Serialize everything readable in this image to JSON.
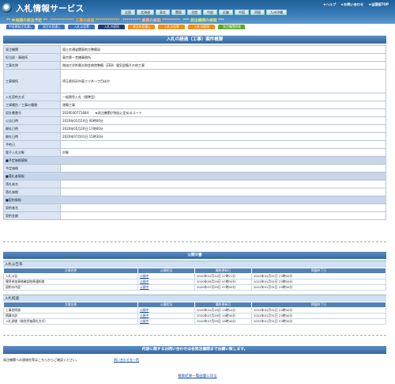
{
  "header": {
    "title": "入札情報サービス",
    "top_links": [
      "★ヘルプ",
      "★お問い合わせ",
      "★全国版TOP"
    ],
    "regions": [
      "全国",
      "北海道",
      "東北",
      "関東",
      "北陸",
      "中部",
      "近畿",
      "中国",
      "四国",
      "九州沖縄"
    ],
    "categories": [
      "** 中長期の発注予定 **",
      "************ 工事の検索 ************",
      "********* 業務の検索 *********",
      "*** 発注機関の検索 ***"
    ]
  },
  "subtabs": [
    "中長期発注見通し",
    "発注の見通し",
    "入札公告等",
    "入札の経過",
    "発注の見通し",
    "入札公告等",
    "入札の経過",
    "発注機関情報"
  ],
  "detail": {
    "heading": "入札の経過（工事）案件概要",
    "rows": [
      {
        "k": "発注機関",
        "v": "国土交通省関東地方整備局"
      },
      {
        "k": "担当部・事務所",
        "v": "東京第一営繕事務所"
      },
      {
        "k": "工事名称",
        "v": "独協大学附属光和会病院整備（ZEB）電気設備その他工事"
      },
      {
        "k": "工事場所",
        "v": "埼玉県所沢市東二ツ木一丁目ほか"
      },
      {
        "k": "入札契約方式",
        "v": "一般競争入札（標準型）"
      },
      {
        "k": "工事種別／工事の種類",
        "v": "建築工事"
      },
      {
        "k": "設計書番号",
        "v": "2020030771684　　★発注機関が独自に定めるコード"
      },
      {
        "k": "公告日時",
        "v": "2020年01月14日 00時00分"
      },
      {
        "k": "開札日時",
        "v": "2020年05月20日 17時00分"
      },
      {
        "k": "開札日時",
        "v": "2020年07月01日 15時30分"
      },
      {
        "k": "予約日",
        "v": ""
      },
      {
        "k": "電子入札対象",
        "v": "対象"
      }
    ],
    "sections": [
      {
        "head": "■予定価格情報",
        "rows": [
          {
            "k": "予定価格",
            "v": ""
          }
        ]
      },
      {
        "head": "■落札者情報",
        "rows": [
          {
            "k": "落札者名",
            "v": ""
          },
          {
            "k": "落札価格",
            "v": ""
          }
        ]
      },
      {
        "head": "■契約情報",
        "rows": [
          {
            "k": "契約者名",
            "v": ""
          },
          {
            "k": "契約金額",
            "v": ""
          }
        ]
      }
    ]
  },
  "public": {
    "heading": "公開文書",
    "notice_title": "入札公告等",
    "columns": [
      "文書名称",
      "公開状況",
      "最終更新日",
      "掲載終了日"
    ],
    "notice_rows": [
      [
        "入札公告",
        "公開中",
        "2020年01月14日 17時21分",
        "2022年01月31日 23時00分"
      ],
      [
        "競争参加資格確認結果通知書",
        "公開中",
        "2020年05月29日 07時00分",
        "2022年01月31日 23時00分"
      ],
      [
        "契約の内容",
        "公開中",
        "2020年07月29日 07時00分",
        "2022年01月31日 23時00分"
      ]
    ],
    "progress_title": "入札経過",
    "progress_rows": [
      [
        "工事説明書",
        "公開中",
        "2020年01月15日 13時22分",
        "2022年01月31日 23時00分"
      ],
      [
        "積算内訳",
        "公開中",
        "2020年07月29日 19時40分",
        "2022年01月31日 23時00分"
      ],
      [
        "入札調書（総合評価落札方式）",
        "公開中",
        "2020年07月29日 19時40分",
        "2022年01月31日 23時00分"
      ]
    ]
  },
  "contact": {
    "heading": "内容に関するお問い合わせは各発注機関までお願い致します。",
    "left_text": "発注機関への連絡先等はこちらからご確認ください。",
    "link": "問い合わせ先一覧"
  },
  "back_link": "検索結果一覧画面に戻る"
}
